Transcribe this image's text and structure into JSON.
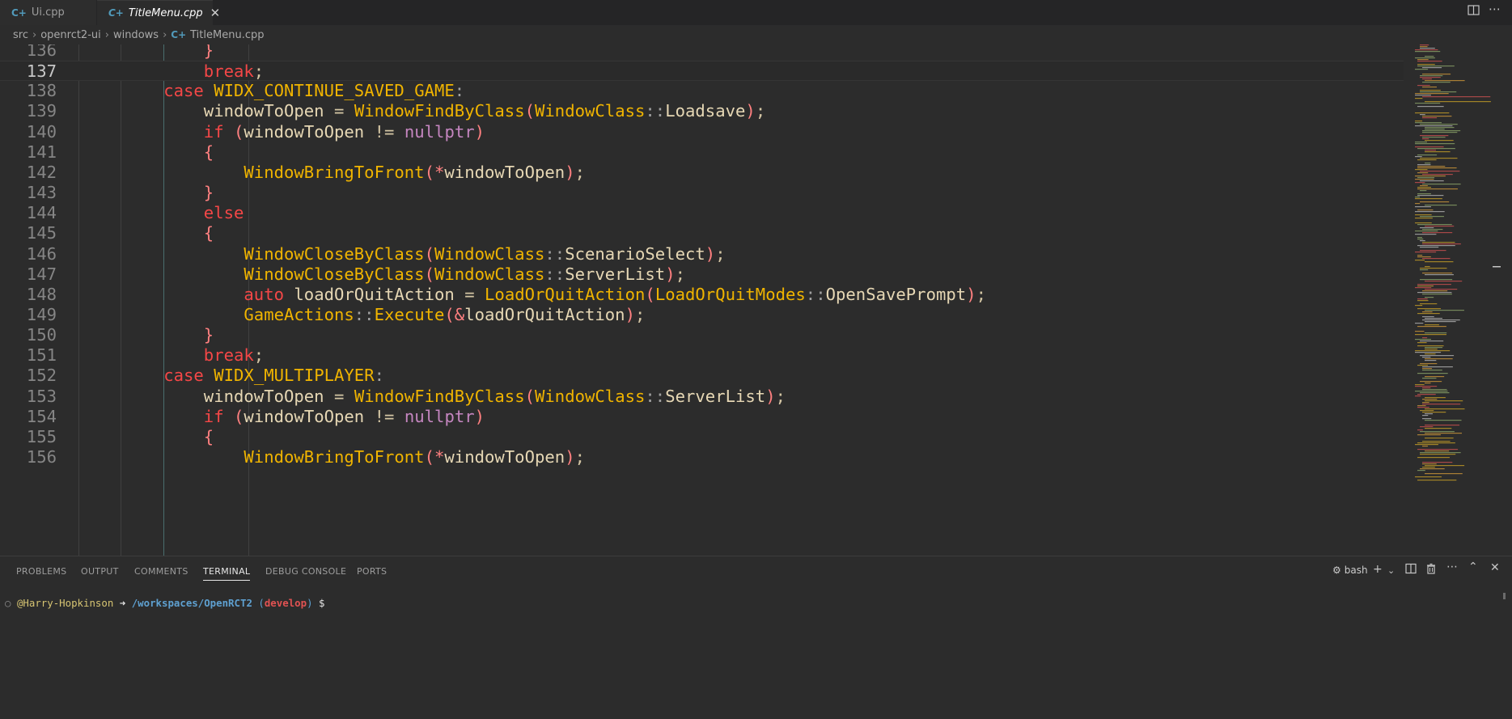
{
  "tabs": [
    {
      "label": "Ui.cpp",
      "icon": "cpp-file-icon",
      "active": false
    },
    {
      "label": "TitleMenu.cpp",
      "icon": "cpp-file-icon",
      "active": true
    }
  ],
  "tabbar_actions": {
    "split": "split-editor-icon",
    "more": "more-actions-icon"
  },
  "breadcrumb": [
    "src",
    "openrct2-ui",
    "windows",
    "TitleMenu.cpp"
  ],
  "editor": {
    "current_line": "137",
    "lines": [
      {
        "n": "136",
        "text": "            }"
      },
      {
        "n": "137",
        "text": "            break;"
      },
      {
        "n": "138",
        "text": "        case WIDX_CONTINUE_SAVED_GAME:"
      },
      {
        "n": "139",
        "text": "            windowToOpen = WindowFindByClass(WindowClass::Loadsave);"
      },
      {
        "n": "140",
        "text": "            if (windowToOpen != nullptr)"
      },
      {
        "n": "141",
        "text": "            {"
      },
      {
        "n": "142",
        "text": "                WindowBringToFront(*windowToOpen);"
      },
      {
        "n": "143",
        "text": "            }"
      },
      {
        "n": "144",
        "text": "            else"
      },
      {
        "n": "145",
        "text": "            {"
      },
      {
        "n": "146",
        "text": "                WindowCloseByClass(WindowClass::ScenarioSelect);"
      },
      {
        "n": "147",
        "text": "                WindowCloseByClass(WindowClass::ServerList);"
      },
      {
        "n": "148",
        "text": "                auto loadOrQuitAction = LoadOrQuitAction(LoadOrQuitModes::OpenSavePrompt);"
      },
      {
        "n": "149",
        "text": "                GameActions::Execute(&loadOrQuitAction);"
      },
      {
        "n": "150",
        "text": "            }"
      },
      {
        "n": "151",
        "text": "            break;"
      },
      {
        "n": "152",
        "text": "        case WIDX_MULTIPLAYER:"
      },
      {
        "n": "153",
        "text": "            windowToOpen = WindowFindByClass(WindowClass::ServerList);"
      },
      {
        "n": "154",
        "text": "            if (windowToOpen != nullptr)"
      },
      {
        "n": "155",
        "text": "            {"
      },
      {
        "n": "156",
        "text": "                WindowBringToFront(*windowToOpen);"
      }
    ]
  },
  "panel": {
    "tabs": [
      "PROBLEMS",
      "OUTPUT",
      "COMMENTS",
      "TERMINAL",
      "DEBUG CONSOLE",
      "PORTS"
    ],
    "active_tab": "TERMINAL",
    "terminal_name": "bash",
    "actions": [
      "add-terminal-icon",
      "chevron-down-icon",
      "split-terminal-icon",
      "trash-icon",
      "more-actions-icon",
      "maximize-panel-icon",
      "close-icon"
    ]
  },
  "terminal": {
    "bullet": "○",
    "user": "@Harry-Hopkinson",
    "arrow": "➜",
    "path": "/workspaces/OpenRCT2",
    "branch_open": "(",
    "branch": "develop",
    "branch_close": ")",
    "dollar": "$"
  },
  "colors": {
    "editor_bg": "#2c2c2c",
    "keyword": "#f44747",
    "function": "#f0b400",
    "variable": "#e6d7b4",
    "tab_icon": "#519aba"
  }
}
